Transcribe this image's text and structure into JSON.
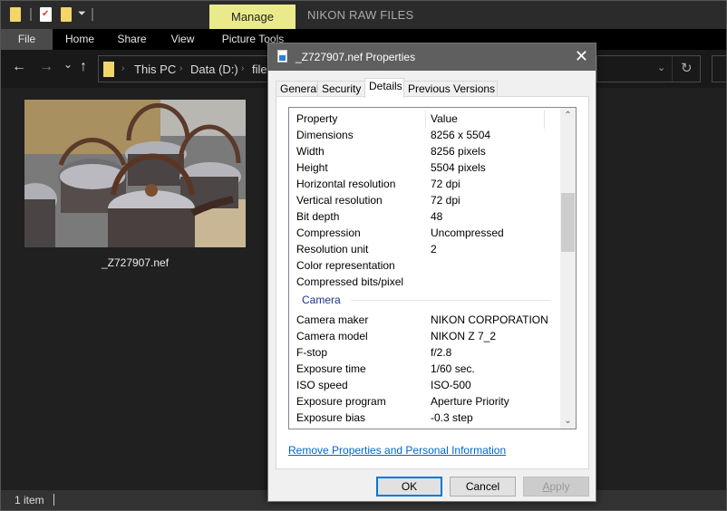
{
  "explorer": {
    "window_title": "NIKON RAW FILES",
    "contextual_tab": "Manage",
    "ribbon_tabs": [
      "File",
      "Home",
      "Share",
      "View",
      "Picture Tools"
    ],
    "breadcrumb": [
      "This PC",
      "Data (D:)",
      "file"
    ],
    "nav": {
      "back": "←",
      "forward": "→",
      "recent": "⌄",
      "up": "↑",
      "refresh": "↻",
      "dropdown": "⌄"
    },
    "files": [
      {
        "name": "_Z727907.nef",
        "type": "image-thumbnail"
      }
    ],
    "status": {
      "item_count": "1 item"
    }
  },
  "dialog": {
    "title": "_Z727907.nef Properties",
    "close": "✕",
    "tabs": [
      {
        "label": "General",
        "active": false
      },
      {
        "label": "Security",
        "active": false
      },
      {
        "label": "Details",
        "active": true
      },
      {
        "label": "Previous Versions",
        "active": false
      }
    ],
    "columns": {
      "property": "Property",
      "value": "Value"
    },
    "image_rows": [
      {
        "k": "Dimensions",
        "v": "8256 x 5504"
      },
      {
        "k": "Width",
        "v": "8256 pixels"
      },
      {
        "k": "Height",
        "v": "5504 pixels"
      },
      {
        "k": "Horizontal resolution",
        "v": "72 dpi"
      },
      {
        "k": "Vertical resolution",
        "v": "72 dpi"
      },
      {
        "k": "Bit depth",
        "v": "48"
      },
      {
        "k": "Compression",
        "v": "Uncompressed"
      },
      {
        "k": "Resolution unit",
        "v": "2"
      },
      {
        "k": "Color representation",
        "v": ""
      },
      {
        "k": "Compressed bits/pixel",
        "v": ""
      }
    ],
    "camera_group": "Camera",
    "camera_rows": [
      {
        "k": "Camera maker",
        "v": "NIKON CORPORATION"
      },
      {
        "k": "Camera model",
        "v": "NIKON Z 7_2"
      },
      {
        "k": "F-stop",
        "v": "f/2.8"
      },
      {
        "k": "Exposure time",
        "v": "1/60 sec."
      },
      {
        "k": "ISO speed",
        "v": "ISO-500"
      },
      {
        "k": "Exposure program",
        "v": "Aperture Priority"
      },
      {
        "k": "Exposure bias",
        "v": "-0.3 step"
      }
    ],
    "scroll_position": 0.3,
    "remove_link": "Remove Properties and Personal Information",
    "buttons": {
      "ok": "OK",
      "cancel": "Cancel",
      "apply": "Apply",
      "apply_enabled": false
    }
  }
}
